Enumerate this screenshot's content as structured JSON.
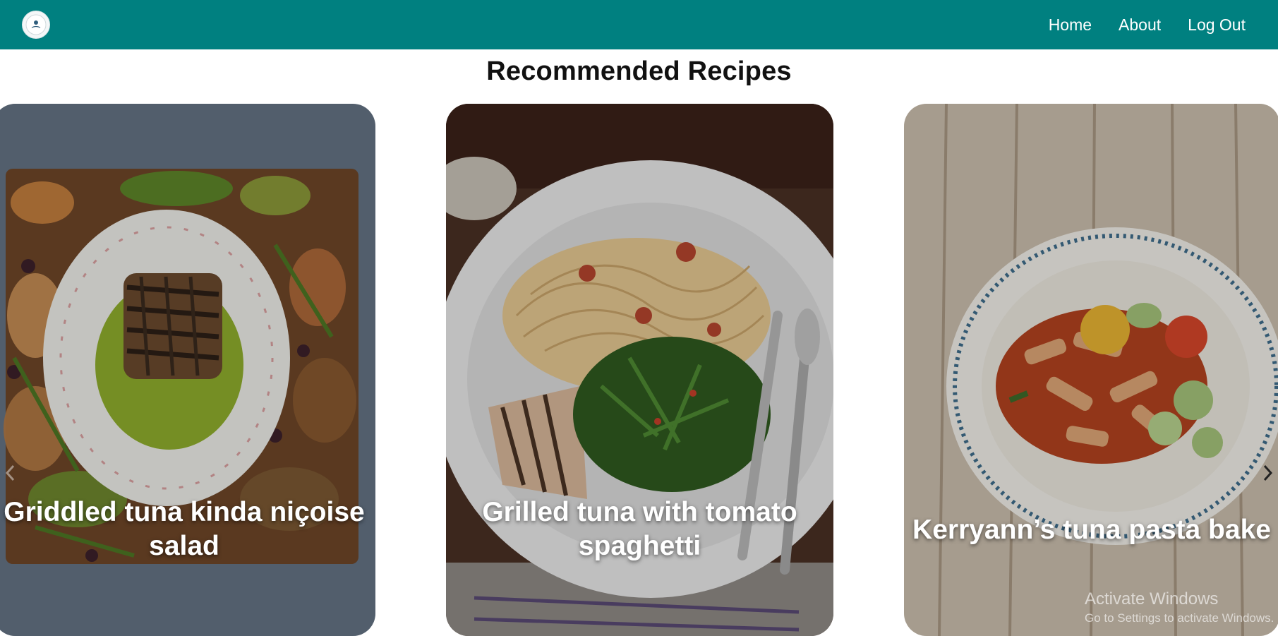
{
  "nav": {
    "logo_icon": "brand-logo-icon",
    "links": [
      "Home",
      "About",
      "Log Out"
    ],
    "background": "#008080"
  },
  "page": {
    "title": "Recommended Recipes"
  },
  "recipes": [
    {
      "title": "Griddled tuna kinda niçoise salad",
      "image_icon": "nicoise-salad-photo"
    },
    {
      "title": "Grilled tuna with tomato spaghetti",
      "image_icon": "tuna-spaghetti-photo"
    },
    {
      "title": "Kerryann’s tuna pasta bake",
      "image_icon": "tuna-pasta-bake-photo"
    }
  ],
  "carousel": {
    "prev_icon": "chevron-left-icon",
    "next_icon": "chevron-right-icon"
  },
  "watermark": {
    "line1": "Activate Windows",
    "line2": "Go to Settings to activate Windows."
  }
}
